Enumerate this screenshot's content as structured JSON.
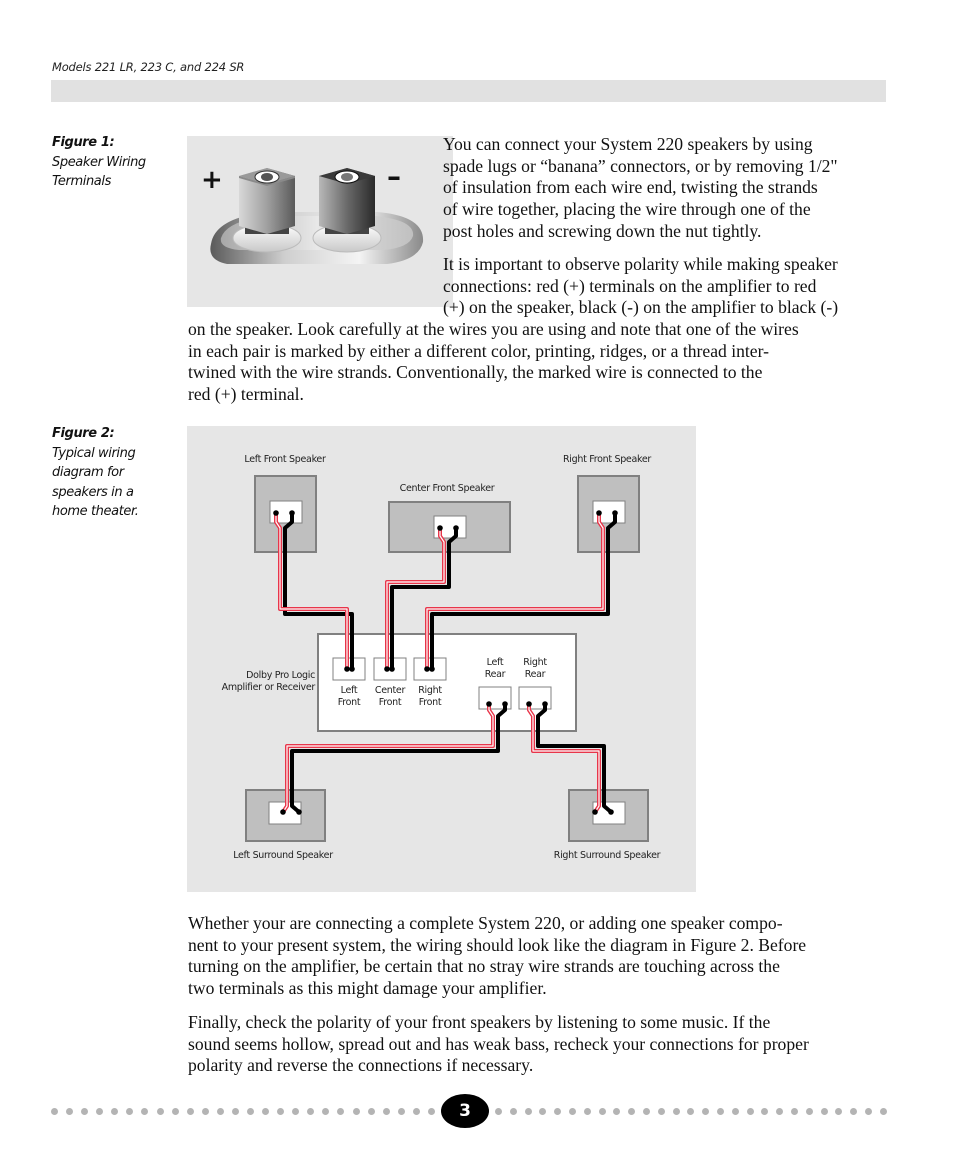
{
  "header": {
    "running_title": "Models 221 LR, 223 C, and 224 SR"
  },
  "figure1": {
    "caption_title": "Figure 1:",
    "caption_lines": [
      "Speaker Wiring",
      "Terminals"
    ],
    "plus_label": "+",
    "minus_label": "–",
    "terminal_colors": {
      "positive": "#9a9a9a",
      "negative": "#3a3a3a"
    }
  },
  "paragraphs": {
    "p1": [
      "You can connect your System 220 speakers by using",
      "spade lugs or “banana” connectors, or by removing 1/2\"",
      "of insulation from each wire end, twisting the strands",
      "of wire together, placing the wire through one of the",
      "post holes and screwing down the nut tightly."
    ],
    "p2a": [
      "It is important to observe polarity while making speaker",
      "connections: red (+) terminals on the amplifier to red",
      "(+) on the speaker, black (-) on the amplifier to black (-)"
    ],
    "p2b": [
      "on the speaker. Look carefully at the wires you are using and note that one of the wires",
      "in each pair is marked by either a different color, printing, ridges, or a thread inter-",
      "twined with the wire strands. Conventionally, the marked wire is connected to the",
      "red (+) terminal."
    ],
    "p3": [
      "Whether your are connecting a complete System 220, or adding one speaker compo-",
      "nent to your present system, the wiring should look like the diagram in Figure 2. Before",
      "turning on the amplifier, be certain that no stray wire strands are touching across the",
      "two terminals as this might damage your amplifier."
    ],
    "p4": [
      "Finally, check the polarity of your front speakers by listening to some music. If the",
      "sound seems hollow, spread out and has weak bass, recheck your connections for proper",
      "polarity and reverse the connections if necessary."
    ]
  },
  "figure2": {
    "caption_title": "Figure 2:",
    "caption_lines": [
      "Typical wiring",
      "diagram for",
      "speakers in a",
      "home theater."
    ],
    "speakers": {
      "left_front": "Left Front Speaker",
      "center_front": "Center Front Speaker",
      "right_front": "Right Front Speaker",
      "left_surround": "Left Surround Speaker",
      "right_surround": "Right Surround Speaker"
    },
    "amplifier": {
      "label_lines": [
        "Dolby Pro Logic",
        "Amplifier or Receiver"
      ],
      "outputs": {
        "left_front": [
          "Left",
          "Front"
        ],
        "center_front": [
          "Center",
          "Front"
        ],
        "right_front": [
          "Right",
          "Front"
        ],
        "left_rear": [
          "Left",
          "Rear"
        ],
        "right_rear": [
          "Right",
          "Rear"
        ]
      }
    },
    "wire_colors": {
      "positive": "#e8354a",
      "negative": "#000000"
    }
  },
  "footer": {
    "page_number": "3"
  }
}
